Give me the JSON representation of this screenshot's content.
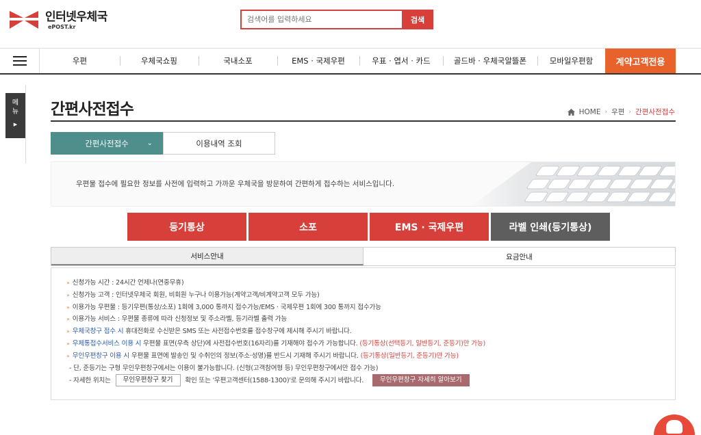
{
  "header": {
    "logo_title": "인터넷우체국",
    "logo_sub": "ePOST.kr",
    "search_placeholder": "검색어를 입력하세요",
    "search_button": "검색"
  },
  "nav": {
    "items": [
      {
        "label": "우편"
      },
      {
        "label": "우체국쇼핑"
      },
      {
        "label": "국내소포"
      },
      {
        "label": "EMS · 국제우편"
      },
      {
        "label": "우표 · 엽서 · 카드"
      },
      {
        "label": "골드바 · 우체국알뜰폰"
      },
      {
        "label": "모바일우편함"
      },
      {
        "label": "계약고객전용"
      }
    ]
  },
  "side": {
    "label1": "메",
    "label2": "뉴",
    "arrow": "▶"
  },
  "page": {
    "title": "간편사전접수",
    "breadcrumb": {
      "home": "HOME",
      "level1": "우편",
      "current": "간편사전접수"
    }
  },
  "subtabs": {
    "tab1": "간편사전접수",
    "tab2": "이용내역 조회"
  },
  "banner": {
    "text": "우편물 접수에 필요한 정보를 사전에 입력하고 가까운 우체국을 방문하여 간편하게 접수하는 서비스입니다."
  },
  "actions": {
    "btn1": "등기통상",
    "btn2": "소포",
    "btn3": "EMS · 국제우편",
    "btn4": "라벨 인쇄(등기통상)"
  },
  "infotabs": {
    "tab1": "서비스안내",
    "tab2": "요금안내"
  },
  "info": {
    "l1": "신청가능 시간 : 24시간 언제나(연중무휴)",
    "l2": "신청가능 고객 : 인터넷우체국 회원, 비회원 누구나 이용가능(계약고객/비계약고객 모두 가능)",
    "l3": "이용가능 우편물 : 등기우편(통상/소포) 1회에 3,000 통까지 접수가능/EMS · 국제우편 1회에 300 통까지 접수가능",
    "l4": "이용가능 서비스 : 우편물 종류에 따라 신청정보 및 주소라벨, 등기라벨 출력 가능",
    "l5_blue": "우체국창구 접수 시",
    "l5_rest": " 휴대전화로 수신받은 SMS 또는 사전접수번호를 접수창구에 제시해 주시기 바랍니다.",
    "l6_blue": "우체통접수서비스 이용 시",
    "l6_rest": " 우편물 표면(우측 상단)에 사전접수번호(16자리)를 기재해야 접수가 가능합니다.",
    "l6_red": " (등기통상(선택등기, 일반등기, 준등기)만 가능)",
    "l7_blue": "무인우편창구 이용 시",
    "l7_rest": " 우편물 표면에 발송인 및 수취인의 정보(주소·성명)를 반드시 기재해 주시기 바랍니다.",
    "l7_red": " (등기통상(일반등기, 준등기)만 가능)",
    "l8": "- 단, 준등기는 구형 무인우편창구에서는 이용이 불가능합니다. (신형(고객참여형 등) 무인우편창구에서만 접수 가능)",
    "l9_prefix": "- 자세한 위치는",
    "l9_btn": "무인우편창구 찾기",
    "l9_mid": "확인 또는 '우편고객센터(1588-1300)'로 문의해 주시기 바랍니다.",
    "l9_btn2": "무인우편창구 자세히 알아보기"
  },
  "colors": {
    "primary_red": "#d7403a",
    "nav_active": "#e8622c",
    "subtab_active": "#4e8f8c"
  }
}
